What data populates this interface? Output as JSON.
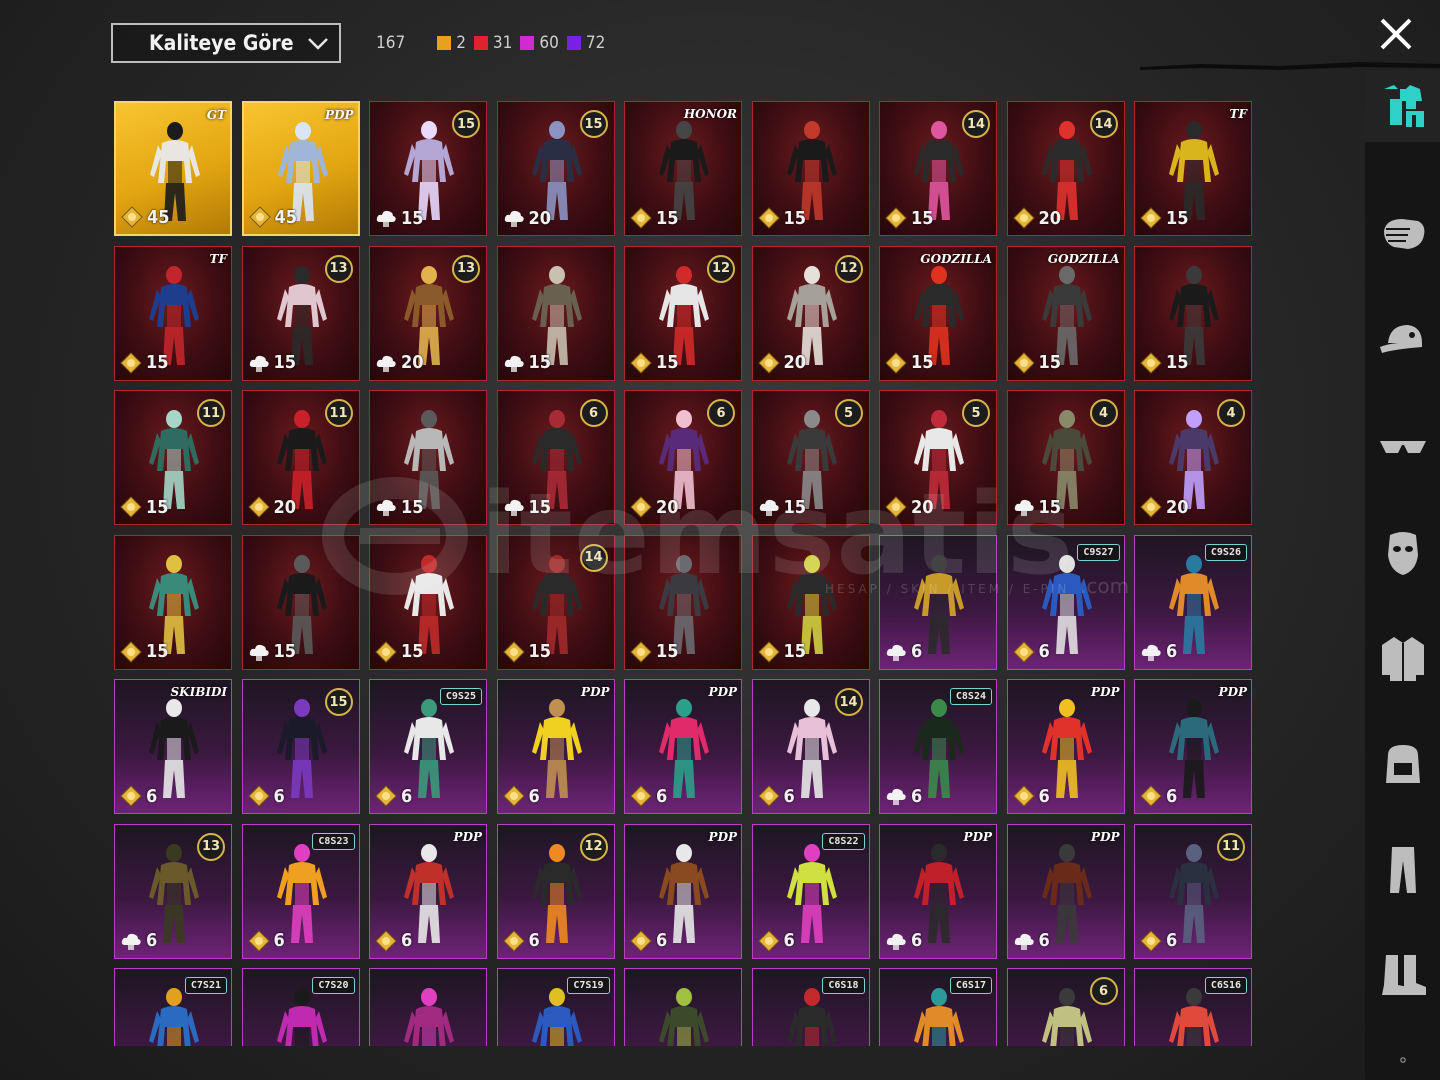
{
  "toolbar": {
    "sort_label": "Kaliteye Göre",
    "total": "167",
    "quality_counts": [
      {
        "color": "#e9a11d",
        "count": "2"
      },
      {
        "color": "#e0222d",
        "count": "31"
      },
      {
        "color": "#d02bd2",
        "count": "60"
      },
      {
        "color": "#7a20e6",
        "count": "72"
      }
    ]
  },
  "watermark": {
    "text": "itemsatis",
    "sub": "HESAP / SKIN / ITEM / E-PIN",
    "domain": ".com"
  },
  "items": [
    {
      "tier": "gold",
      "mark": "logo",
      "mark_text": "GT",
      "cost_icon": "coin",
      "cost": "45",
      "fig": "#e9e6e2",
      "accent": "#1b1b1b"
    },
    {
      "tier": "gold",
      "mark": "logo",
      "mark_text": "PDP",
      "cost_icon": "coin",
      "cost": "45",
      "fig": "#9fb6d8",
      "accent": "#d9e6f7"
    },
    {
      "tier": "red",
      "mark": "badge",
      "mark_text": "15",
      "cost_icon": "cloud",
      "cost": "15",
      "fig": "#b4a7d6",
      "accent": "#e8d9ff"
    },
    {
      "tier": "red",
      "mark": "badge",
      "mark_text": "15",
      "cost_icon": "cloud",
      "cost": "20",
      "fig": "#2a2e45",
      "accent": "#8b93c2"
    },
    {
      "tier": "red",
      "mark": "logo",
      "mark_text": "HONOR",
      "cost_icon": "coin",
      "cost": "15",
      "fig": "#1a1a1a",
      "accent": "#454545"
    },
    {
      "tier": "red",
      "mark": "none",
      "mark_text": "",
      "cost_icon": "coin",
      "cost": "15",
      "fig": "#1a1a1a",
      "accent": "#c0392b"
    },
    {
      "tier": "red",
      "mark": "badge",
      "mark_text": "14",
      "cost_icon": "coin",
      "cost": "15",
      "fig": "#2a2a2a",
      "accent": "#e055a0"
    },
    {
      "tier": "red",
      "mark": "badge",
      "mark_text": "14",
      "cost_icon": "coin",
      "cost": "20",
      "fig": "#2b2b2b",
      "accent": "#e0322d"
    },
    {
      "tier": "red",
      "mark": "logo",
      "mark_text": "TF",
      "cost_icon": "coin",
      "cost": "15",
      "fig": "#d8b51d",
      "accent": "#2a2a2a"
    },
    {
      "tier": "red",
      "mark": "logo",
      "mark_text": "TF",
      "cost_icon": "coin",
      "cost": "15",
      "fig": "#1e3d8c",
      "accent": "#c0262b"
    },
    {
      "tier": "red",
      "mark": "badge",
      "mark_text": "13",
      "cost_icon": "cloud",
      "cost": "15",
      "fig": "#e0c6cf",
      "accent": "#2a2a2a"
    },
    {
      "tier": "red",
      "mark": "badge",
      "mark_text": "13",
      "cost_icon": "cloud",
      "cost": "20",
      "fig": "#8a5a2a",
      "accent": "#e0b34c"
    },
    {
      "tier": "red",
      "mark": "none",
      "mark_text": "",
      "cost_icon": "cloud",
      "cost": "15",
      "fig": "#6a6050",
      "accent": "#c8c0b0"
    },
    {
      "tier": "red",
      "mark": "badge",
      "mark_text": "12",
      "cost_icon": "coin",
      "cost": "15",
      "fig": "#e6e6e6",
      "accent": "#d12a2a"
    },
    {
      "tier": "red",
      "mark": "badge",
      "mark_text": "12",
      "cost_icon": "coin",
      "cost": "20",
      "fig": "#a5a09a",
      "accent": "#e6e0da"
    },
    {
      "tier": "red",
      "mark": "logo",
      "mark_text": "GODZILLA",
      "cost_icon": "coin",
      "cost": "15",
      "fig": "#2a2a2a",
      "accent": "#e0321e"
    },
    {
      "tier": "red",
      "mark": "logo",
      "mark_text": "GODZILLA",
      "cost_icon": "coin",
      "cost": "15",
      "fig": "#3a3a3a",
      "accent": "#6a6a6a"
    },
    {
      "tier": "red",
      "mark": "none",
      "mark_text": "",
      "cost_icon": "coin",
      "cost": "15",
      "fig": "#1a1a1a",
      "accent": "#3a3a3a"
    },
    {
      "tier": "red",
      "mark": "badge",
      "mark_text": "11",
      "cost_icon": "coin",
      "cost": "15",
      "fig": "#2f6b5e",
      "accent": "#a5d6c8"
    },
    {
      "tier": "red",
      "mark": "badge",
      "mark_text": "11",
      "cost_icon": "coin",
      "cost": "20",
      "fig": "#1a1a1a",
      "accent": "#c9202a"
    },
    {
      "tier": "red",
      "mark": "none",
      "mark_text": "",
      "cost_icon": "cloud",
      "cost": "15",
      "fig": "#b8b8b8",
      "accent": "#5a5a5a"
    },
    {
      "tier": "red",
      "mark": "badge",
      "mark_text": "6",
      "cost_icon": "cloud",
      "cost": "15",
      "fig": "#2a2a2a",
      "accent": "#a82a35"
    },
    {
      "tier": "red",
      "mark": "badge",
      "mark_text": "6",
      "cost_icon": "coin",
      "cost": "20",
      "fig": "#5a2a7a",
      "accent": "#f0c0d0"
    },
    {
      "tier": "red",
      "mark": "badge",
      "mark_text": "5",
      "cost_icon": "cloud",
      "cost": "15",
      "fig": "#3a3a3a",
      "accent": "#8a8a8a"
    },
    {
      "tier": "red",
      "mark": "badge",
      "mark_text": "5",
      "cost_icon": "coin",
      "cost": "20",
      "fig": "#e8e8e8",
      "accent": "#c02a3a"
    },
    {
      "tier": "red",
      "mark": "badge",
      "mark_text": "4",
      "cost_icon": "cloud",
      "cost": "15",
      "fig": "#4a4a3a",
      "accent": "#8a8a6a"
    },
    {
      "tier": "red",
      "mark": "badge",
      "mark_text": "4",
      "cost_icon": "coin",
      "cost": "20",
      "fig": "#4a3a6a",
      "accent": "#c0a0ff"
    },
    {
      "tier": "red",
      "mark": "none",
      "mark_text": "",
      "cost_icon": "coin",
      "cost": "15",
      "fig": "#3a8a7a",
      "accent": "#e0c040"
    },
    {
      "tier": "red",
      "mark": "none",
      "mark_text": "",
      "cost_icon": "cloud",
      "cost": "15",
      "fig": "#1a1a1a",
      "accent": "#5a5a5a"
    },
    {
      "tier": "red",
      "mark": "none",
      "mark_text": "",
      "cost_icon": "coin",
      "cost": "15",
      "fig": "#e8e8e8",
      "accent": "#c02a2a"
    },
    {
      "tier": "red",
      "mark": "badge",
      "mark_text": "14",
      "cost_icon": "coin",
      "cost": "15",
      "fig": "#2a2a2a",
      "accent": "#a02a2a"
    },
    {
      "tier": "red",
      "mark": "none",
      "mark_text": "",
      "cost_icon": "coin",
      "cost": "15",
      "fig": "#3a3a40",
      "accent": "#6a6a70"
    },
    {
      "tier": "red",
      "mark": "none",
      "mark_text": "",
      "cost_icon": "coin",
      "cost": "15",
      "fig": "#2a2a2a",
      "accent": "#d0d040"
    },
    {
      "tier": "purple",
      "mark": "none",
      "mark_text": "",
      "cost_icon": "cloud",
      "cost": "6",
      "fig": "#c89a2a",
      "accent": "#2a2a2a"
    },
    {
      "tier": "purple",
      "mark": "tag",
      "mark_text": "C9S27",
      "cost_icon": "coin",
      "cost": "6",
      "fig": "#2a5ac0",
      "accent": "#e0e0e0"
    },
    {
      "tier": "purple",
      "mark": "tag",
      "mark_text": "C9S26",
      "cost_icon": "cloud",
      "cost": "6",
      "fig": "#e08a2a",
      "accent": "#2a7aa0"
    },
    {
      "tier": "purple",
      "mark": "logo",
      "mark_text": "SKIBIDI",
      "cost_icon": "coin",
      "cost": "6",
      "fig": "#1a1a1a",
      "accent": "#e8e8e8"
    },
    {
      "tier": "purple",
      "mark": "badge",
      "mark_text": "15",
      "cost_icon": "coin",
      "cost": "6",
      "fig": "#1a1a2a",
      "accent": "#7a3ac0"
    },
    {
      "tier": "purple",
      "mark": "tag",
      "mark_text": "C9S25",
      "cost_icon": "coin",
      "cost": "6",
      "fig": "#e8e8e8",
      "accent": "#3a9a7a"
    },
    {
      "tier": "purple",
      "mark": "logo",
      "mark_text": "PDP",
      "cost_icon": "coin",
      "cost": "6",
      "fig": "#f0d020",
      "accent": "#c09050"
    },
    {
      "tier": "purple",
      "mark": "logo",
      "mark_text": "PDP",
      "cost_icon": "coin",
      "cost": "6",
      "fig": "#e02a6a",
      "accent": "#2aa08a"
    },
    {
      "tier": "purple",
      "mark": "badge",
      "mark_text": "14",
      "cost_icon": "coin",
      "cost": "6",
      "fig": "#e8c0d8",
      "accent": "#e8e8e8"
    },
    {
      "tier": "purple",
      "mark": "tag",
      "mark_text": "C8S24",
      "cost_icon": "cloud",
      "cost": "6",
      "fig": "#1a2a1a",
      "accent": "#3a8a4a"
    },
    {
      "tier": "purple",
      "mark": "logo",
      "mark_text": "PDP",
      "cost_icon": "coin",
      "cost": "6",
      "fig": "#e0322a",
      "accent": "#f0c020"
    },
    {
      "tier": "purple",
      "mark": "logo",
      "mark_text": "PDP",
      "cost_icon": "coin",
      "cost": "6",
      "fig": "#2a6a7a",
      "accent": "#1a1a1a"
    },
    {
      "tier": "purple",
      "mark": "badge",
      "mark_text": "13",
      "cost_icon": "cloud",
      "cost": "6",
      "fig": "#6a5a2a",
      "accent": "#3a3a20"
    },
    {
      "tier": "purple",
      "mark": "tag",
      "mark_text": "C8S23",
      "cost_icon": "coin",
      "cost": "6",
      "fig": "#f0a020",
      "accent": "#e040c0"
    },
    {
      "tier": "purple",
      "mark": "logo",
      "mark_text": "PDP",
      "cost_icon": "coin",
      "cost": "6",
      "fig": "#c0302a",
      "accent": "#e8e8e8"
    },
    {
      "tier": "purple",
      "mark": "badge",
      "mark_text": "12",
      "cost_icon": "coin",
      "cost": "6",
      "fig": "#2a2a2a",
      "accent": "#f08a20"
    },
    {
      "tier": "purple",
      "mark": "logo",
      "mark_text": "PDP",
      "cost_icon": "coin",
      "cost": "6",
      "fig": "#8a4a20",
      "accent": "#e8e8e8"
    },
    {
      "tier": "purple",
      "mark": "tag",
      "mark_text": "C8S22",
      "cost_icon": "coin",
      "cost": "6",
      "fig": "#d0e040",
      "accent": "#e040c0"
    },
    {
      "tier": "purple",
      "mark": "logo",
      "mark_text": "PDP",
      "cost_icon": "cloud",
      "cost": "6",
      "fig": "#c0202a",
      "accent": "#2a2a2a"
    },
    {
      "tier": "purple",
      "mark": "logo",
      "mark_text": "PDP",
      "cost_icon": "cloud",
      "cost": "6",
      "fig": "#6a2a1a",
      "accent": "#3a3a3a"
    },
    {
      "tier": "purple",
      "mark": "badge",
      "mark_text": "11",
      "cost_icon": "coin",
      "cost": "6",
      "fig": "#2a3040",
      "accent": "#5a6080"
    },
    {
      "tier": "purple",
      "mark": "tag",
      "mark_text": "C7S21",
      "cost_icon": "none",
      "cost": "",
      "fig": "#2a6ac0",
      "accent": "#e0a020"
    },
    {
      "tier": "purple",
      "mark": "tag",
      "mark_text": "C7S20",
      "cost_icon": "none",
      "cost": "",
      "fig": "#c02ab0",
      "accent": "#1a1a1a"
    },
    {
      "tier": "purple",
      "mark": "none",
      "mark_text": "",
      "cost_icon": "none",
      "cost": "",
      "fig": "#a02a80",
      "accent": "#e040c0"
    },
    {
      "tier": "purple",
      "mark": "tag",
      "mark_text": "C7S19",
      "cost_icon": "none",
      "cost": "",
      "fig": "#2a5ac0",
      "accent": "#e0c020"
    },
    {
      "tier": "purple",
      "mark": "none",
      "mark_text": "",
      "cost_icon": "none",
      "cost": "",
      "fig": "#3a4a2a",
      "accent": "#a0c040"
    },
    {
      "tier": "purple",
      "mark": "tag",
      "mark_text": "C6S18",
      "cost_icon": "none",
      "cost": "",
      "fig": "#2a2a2a",
      "accent": "#c02a2a"
    },
    {
      "tier": "purple",
      "mark": "tag",
      "mark_text": "C6S17",
      "cost_icon": "none",
      "cost": "",
      "fig": "#e08a2a",
      "accent": "#2a9a9a"
    },
    {
      "tier": "purple",
      "mark": "badge",
      "mark_text": "6",
      "cost_icon": "none",
      "cost": "",
      "fig": "#c0c080",
      "accent": "#3a3a3a"
    },
    {
      "tier": "purple",
      "mark": "tag",
      "mark_text": "C6S16",
      "cost_icon": "none",
      "cost": "",
      "fig": "#e04a3a",
      "accent": "#3a3a3a"
    }
  ],
  "sidebar": [
    {
      "name": "outfit-icon",
      "active": true
    },
    {
      "name": "emote-hand-icon",
      "active": false
    },
    {
      "name": "cap-icon",
      "active": false
    },
    {
      "name": "glasses-icon",
      "active": false
    },
    {
      "name": "mask-icon",
      "active": false
    },
    {
      "name": "jacket-icon",
      "active": false
    },
    {
      "name": "backpack-icon",
      "active": false
    },
    {
      "name": "pants-icon",
      "active": false
    },
    {
      "name": "boots-icon",
      "active": false
    }
  ]
}
